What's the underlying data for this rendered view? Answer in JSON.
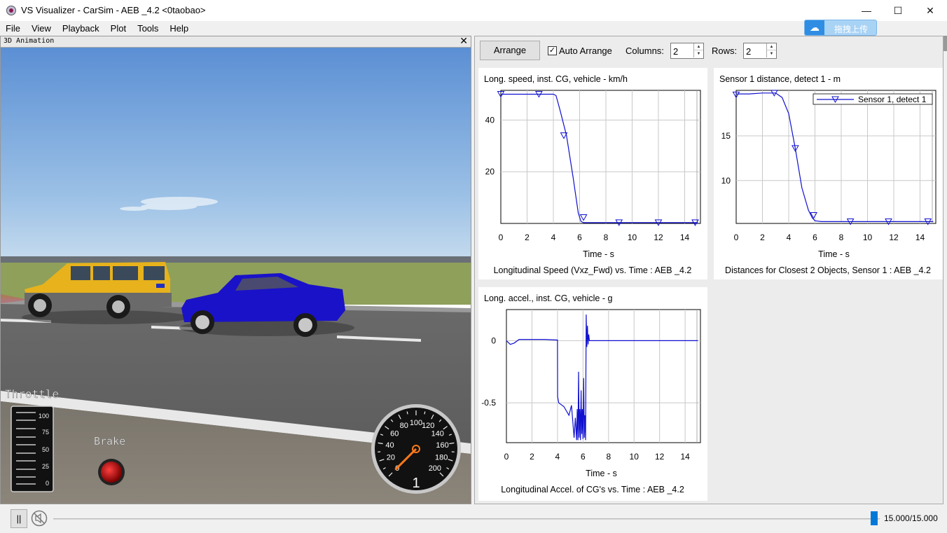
{
  "window": {
    "title": "VS Visualizer - CarSim - AEB _4.2 <0taobao>",
    "minimize_glyph": "—",
    "maximize_glyph": "☐",
    "close_glyph": "✕"
  },
  "upload_button": {
    "label": "拖拽上传",
    "icon": "cloud-icon"
  },
  "menu": [
    "File",
    "View",
    "Playback",
    "Plot",
    "Tools",
    "Help"
  ],
  "animation": {
    "header": "3D Animation",
    "close_glyph": "✕",
    "throttle_label": "Throttle",
    "throttle_ticks": [
      "100",
      "75",
      "50",
      "25",
      "0"
    ],
    "brake_label": "Brake",
    "speedometer": {
      "ticks": [
        "0",
        "20",
        "40",
        "60",
        "80",
        "100",
        "120",
        "140",
        "160",
        "180",
        "200"
      ],
      "gear": "1",
      "needle_value_kmh": 0
    }
  },
  "toolbar": {
    "arrange_label": "Arrange",
    "auto_arrange_label": "Auto Arrange",
    "auto_arrange_checked": true,
    "columns_label": "Columns:",
    "columns_value": "2",
    "rows_label": "Rows:",
    "rows_value": "2"
  },
  "plots": [
    {
      "title": "Long. speed, inst. CG, vehicle - km/h",
      "xlabel": "Time - s",
      "caption": "Longitudinal Speed (Vxz_Fwd) vs. Time : AEB _4.2",
      "x_ticks": [
        "0",
        "2",
        "4",
        "6",
        "8",
        "10",
        "12",
        "14"
      ],
      "y_ticks": [
        "40",
        "20"
      ]
    },
    {
      "title": "Sensor 1 distance, detect 1 - m",
      "xlabel": "Time - s",
      "caption": "Distances for Closest 2 Objects, Sensor 1 : AEB _4.2",
      "legend": "Sensor 1, detect 1",
      "x_ticks": [
        "0",
        "2",
        "4",
        "6",
        "8",
        "10",
        "12",
        "14"
      ],
      "y_ticks": [
        "15",
        "10"
      ]
    },
    {
      "title": "Long. accel., inst. CG, vehicle - g",
      "xlabel": "Time - s",
      "caption": "Longitudinal Accel. of CG's vs. Time : AEB _4.2",
      "x_ticks": [
        "0",
        "2",
        "4",
        "6",
        "8",
        "10",
        "12",
        "14"
      ],
      "y_ticks": [
        "0",
        "-0.5"
      ]
    }
  ],
  "chart_data": [
    {
      "type": "line",
      "title": "Long. speed, inst. CG, vehicle - km/h",
      "xlabel": "Time - s",
      "ylabel": "",
      "xlim": [
        0,
        15.2
      ],
      "ylim": [
        0,
        51.5
      ],
      "grid": true,
      "x": [
        0,
        1,
        2,
        3,
        4,
        4.2,
        4.5,
        5,
        5.5,
        5.9,
        6.1,
        6.3,
        7,
        9,
        11,
        13,
        15
      ],
      "series": [
        {
          "values": [
            50,
            50,
            50,
            50,
            50,
            49.5,
            44,
            34,
            18,
            4,
            0.8,
            0.3,
            0.3,
            0.3,
            0.3,
            0.3,
            0.3
          ]
        }
      ],
      "marker_x": [
        0,
        2.9,
        4.8,
        6.3,
        9,
        12,
        14.8
      ],
      "marker_y": [
        50,
        50,
        34,
        2.3,
        0.3,
        0.3,
        0.3
      ],
      "colors": {
        "line": "#1010d0",
        "grid": "#c8c8c8"
      }
    },
    {
      "type": "line",
      "title": "Sensor 1 distance, detect 1 - m",
      "xlabel": "Time - s",
      "ylabel": "",
      "xlim": [
        0,
        15.2
      ],
      "ylim": [
        5.2,
        20.1
      ],
      "grid": true,
      "legend": "top-right",
      "x": [
        0,
        1,
        2,
        3,
        3.5,
        4,
        4.5,
        5,
        5.5,
        5.8,
        6,
        6.5,
        8,
        10,
        12,
        15
      ],
      "series": [
        {
          "name": "Sensor 1, detect 1",
          "values": [
            19.7,
            19.7,
            19.8,
            19.8,
            19.3,
            17.5,
            13.6,
            9.2,
            6.7,
            5.8,
            5.5,
            5.4,
            5.4,
            5.4,
            5.4,
            5.4
          ]
        }
      ],
      "marker_x": [
        0,
        2.9,
        4.5,
        5.9,
        8.7,
        11.6,
        14.6
      ],
      "marker_y": [
        19.6,
        19.8,
        13.6,
        6.1,
        5.4,
        5.4,
        5.4
      ],
      "colors": {
        "line": "#1010d0",
        "grid": "#c8c8c8"
      }
    },
    {
      "type": "line",
      "title": "Long. accel., inst. CG, vehicle - g",
      "xlabel": "Time - s",
      "ylabel": "",
      "xlim": [
        0,
        15.2
      ],
      "ylim": [
        -0.82,
        0.25
      ],
      "grid": true,
      "x": [
        0,
        0.3,
        0.6,
        1,
        1.5,
        2,
        3,
        4,
        4.01,
        4.1,
        4.5,
        4.9,
        5.1,
        5.3,
        5.4,
        5.5,
        5.55,
        5.6,
        5.65,
        5.7,
        5.75,
        5.8,
        5.85,
        5.9,
        5.95,
        6.0,
        6.05,
        6.1,
        6.15,
        6.2,
        6.25,
        6.3,
        6.35,
        6.4,
        6.45,
        6.5,
        6.6,
        7,
        10,
        15
      ],
      "series": [
        {
          "values": [
            0,
            -0.03,
            -0.02,
            0.01,
            0.01,
            0.01,
            0.01,
            0.005,
            -0.45,
            -0.5,
            -0.53,
            -0.6,
            -0.52,
            -0.78,
            -0.62,
            -0.8,
            -0.55,
            -0.8,
            -0.25,
            -0.78,
            -0.55,
            -0.8,
            -0.4,
            -0.75,
            -0.55,
            -0.79,
            -0.3,
            -0.78,
            -0.6,
            -0.8,
            0.21,
            -0.05,
            0.12,
            -0.03,
            0.05,
            0,
            0,
            0,
            0,
            0
          ]
        }
      ],
      "colors": {
        "line": "#1010d0",
        "grid": "#c8c8c8"
      }
    }
  ],
  "playback": {
    "pause_glyph": "||",
    "time_readout": "15.000/15.000",
    "position_fraction": 1.0
  }
}
